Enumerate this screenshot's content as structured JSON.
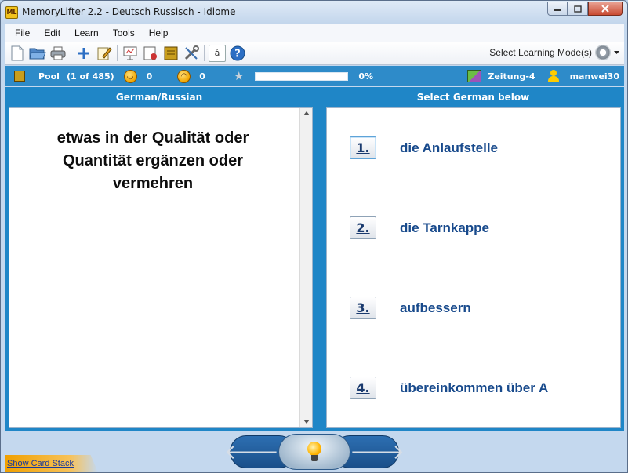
{
  "window": {
    "app_icon": "ML",
    "title": "MemoryLifter 2.2 - Deutsch Russisch - Idiome",
    "controls": [
      "minimize",
      "maximize",
      "close"
    ]
  },
  "menu": {
    "items": [
      "File",
      "Edit",
      "Learn",
      "Tools",
      "Help"
    ]
  },
  "toolbar": {
    "icons": [
      "new-file-icon",
      "open-folder-icon",
      "print-icon",
      "add-card-icon",
      "edit-icon",
      "presentation-icon",
      "print-cards-icon",
      "card-box-icon",
      "tools-icon",
      "special-char-icon",
      "help-icon"
    ],
    "special_char": "á",
    "help_char": "?",
    "mode_label": "Select Learning Mode(s)"
  },
  "status": {
    "pool_label": "Pool",
    "pool_count": "(1 of 485)",
    "correct": "0",
    "wrong": "0",
    "progress_percent": 0,
    "progress_label": "0%",
    "box_label": "Zeitung-4",
    "user": "manwei30"
  },
  "main": {
    "left_header": "German/Russian",
    "right_header": "Select German below",
    "question": "etwas in der Qualität oder Quantität ergänzen oder vermehren",
    "answers": [
      {
        "num": "1.",
        "text": "die Anlaufstelle"
      },
      {
        "num": "2.",
        "text": "die Tarnkappe"
      },
      {
        "num": "3.",
        "text": "aufbessern"
      },
      {
        "num": "4.",
        "text": "übereinkommen über A"
      }
    ]
  },
  "bottom": {
    "show_card_stack": "Show Card Stack",
    "prev_arrow": "🡐",
    "next_arrow": "🡒"
  },
  "colors": {
    "accent_blue": "#1f86c7",
    "status_blue": "#2e8bc9",
    "answer_text": "#184a8c",
    "progress_fill": "#7cc36b"
  }
}
